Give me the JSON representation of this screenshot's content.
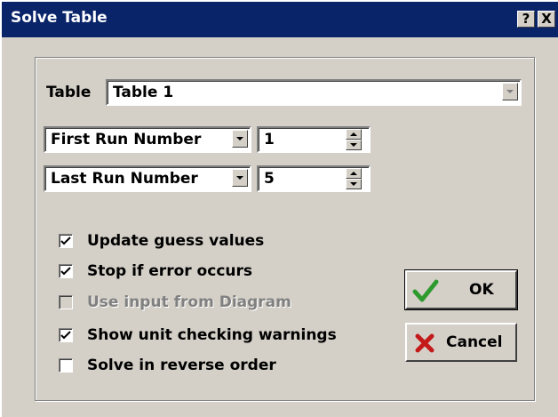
{
  "window": {
    "title": "Solve Table",
    "help_glyph": "?",
    "close_glyph": "X"
  },
  "table_row": {
    "label": "Table",
    "selected": "Table 1"
  },
  "first_run": {
    "selector": "First Run Number",
    "value": "1"
  },
  "last_run": {
    "selector": "Last Run Number",
    "value": "5"
  },
  "options": [
    {
      "label": "Update guess values",
      "checked": true,
      "enabled": true
    },
    {
      "label": "Stop if error occurs",
      "checked": true,
      "enabled": true
    },
    {
      "label": "Use input from Diagram",
      "checked": false,
      "enabled": false
    },
    {
      "label": "Show unit checking warnings",
      "checked": true,
      "enabled": true
    },
    {
      "label": "Solve in reverse order",
      "checked": false,
      "enabled": true
    }
  ],
  "buttons": {
    "ok_label": "OK",
    "ok_icon": "green-check-icon",
    "cancel_label": "Cancel",
    "cancel_icon": "red-x-icon"
  },
  "colors": {
    "titlebar": "#0a246a",
    "dialog_bg": "#d4d0c8",
    "ok_check": "#2e9a2e",
    "cancel_x": "#c41a1a"
  }
}
